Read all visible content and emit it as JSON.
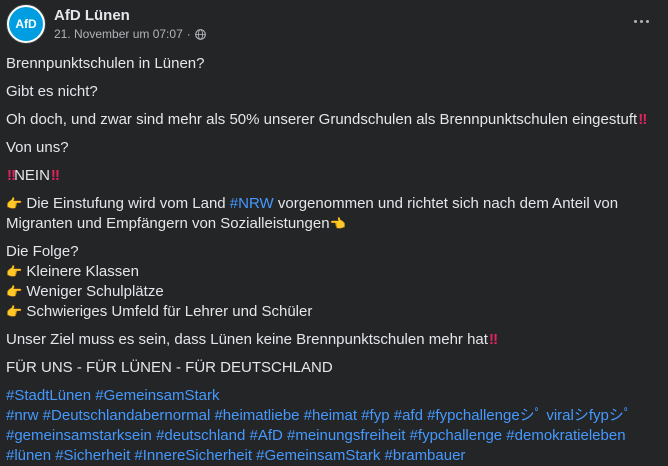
{
  "post": {
    "page_name": "AfD Lünen",
    "timestamp": "21. November um 07:07",
    "meta_separator": "·",
    "avatar_text": "AfD"
  },
  "content": {
    "p1": "Brennpunktschulen in Lünen?",
    "p2": "Gibt es nicht?",
    "p3": "Oh doch, und zwar sind mehr als 50% unserer Grundschulen als Brennpunktschulen eingestuft",
    "p4": "Von uns?",
    "p5": "NEIN",
    "p6a": "Die Einstufung wird vom Land ",
    "p6_tag": "#NRW",
    "p6b": " vorgenommen und richtet sich nach dem Anteil von Migranten und Empfängern von Sozialleistungen",
    "p7_title": "Die Folge?",
    "bullets": [
      "Kleinere Klassen",
      "Weniger Schulplätze",
      "Schwieriges Umfeld für Lehrer und Schüler"
    ],
    "p8": "Unser Ziel muss es sein, dass Lünen keine Brennpunktschulen mehr hat",
    "p9": "FÜR UNS - FÜR LÜNEN - FÜR DEUTSCHLAND",
    "tags_line1": "#StadtLünen #GemeinsamStark",
    "tags_line2": " #nrw #Deutschlandabernormal #heimatliebe #heimat #fyp #afd #fypchallengeシﾟ viralシfypシﾟ #gemeinsamstarksein #deutschland #AfD #meinungsfreiheit #fypchallenge #demokratieleben #lünen #Sicherheit #InnereSicherheit #GemeinsamStark #brambauer"
  },
  "emoji": {
    "double_exclamation": "‼",
    "point_right": "👉",
    "point_left": "👈"
  },
  "colors": {
    "background": "#242526",
    "text": "#e4e6eb",
    "secondary": "#b0b3b8",
    "link": "#4599ff"
  }
}
